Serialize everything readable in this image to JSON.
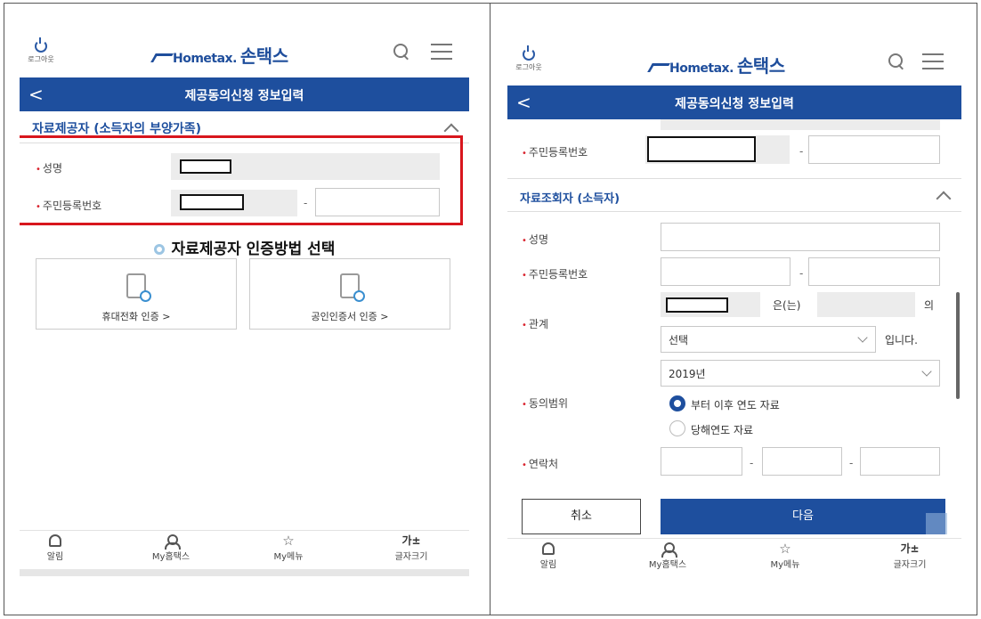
{
  "left": {
    "header": {
      "logout_label": "로그아웃",
      "logo_text": "Hometax.",
      "logo_sub": "손택스"
    },
    "nav": {
      "back": "<",
      "title": "제공동의신청 정보입력"
    },
    "section_provider": {
      "label": "자료제공자 (소득자의 부양가족)"
    },
    "fields": {
      "name_label": "성명",
      "rrn_label": "주민등록번호",
      "dash": "-"
    },
    "auth": {
      "title": "자료제공자 인증방법 선택",
      "phone_label": "휴대전화 인증  >",
      "cert_label": "공인인증서 인증  >"
    },
    "bottom": {
      "alarm": "알림",
      "my_hometax": "My홈택스",
      "my_menu": "My메뉴",
      "font_glyph": "가±",
      "font_size": "글자크기"
    }
  },
  "right": {
    "header": {
      "logout_label": "로그아웃",
      "logo_text": "Hometax.",
      "logo_sub": "손택스"
    },
    "nav": {
      "back": "<",
      "title": "제공동의신청 정보입력"
    },
    "fields_top": {
      "rrn_label": "주민등록번호",
      "dash": "-"
    },
    "section_viewer": {
      "label": "자료조회자 (소득자)"
    },
    "viewer": {
      "name_label": "성명",
      "rrn_label": "주민등록번호",
      "relation_label": "관계",
      "relation_eun": "은(는)",
      "relation_ui": "의",
      "relation_select": "선택",
      "relation_suffix": "입니다.",
      "consent_label": "동의범위",
      "year_select": "2019년",
      "radio_after": "부터 이후 연도 자료",
      "radio_current": "당해연도 자료",
      "contact_label": "연락처",
      "dash": "-"
    },
    "buttons": {
      "cancel": "취소",
      "next": "다음"
    },
    "bottom": {
      "alarm": "알림",
      "my_hometax": "My홈택스",
      "my_menu": "My메뉴",
      "font_glyph": "가±",
      "font_size": "글자크기"
    }
  }
}
